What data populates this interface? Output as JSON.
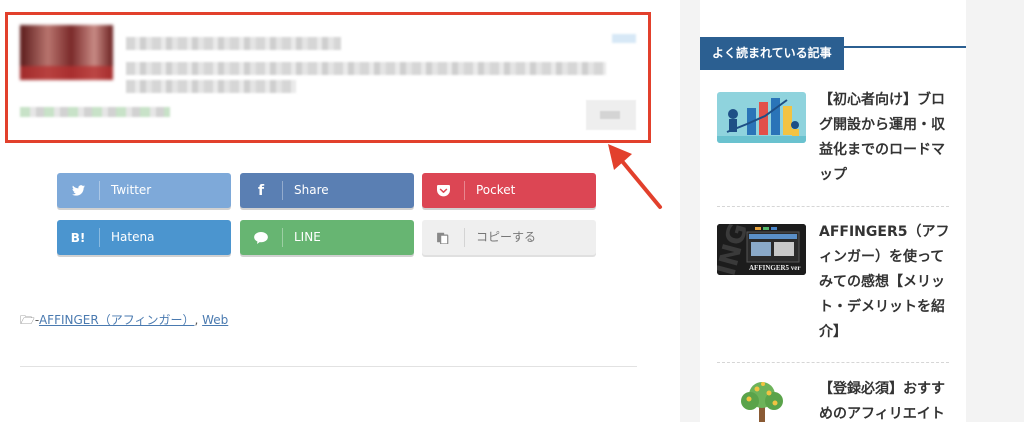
{
  "share_buttons": [
    {
      "label": "Twitter",
      "icon": "twitter-icon",
      "glyph": "🐦"
    },
    {
      "label": "Share",
      "icon": "facebook-icon",
      "glyph": "f"
    },
    {
      "label": "Pocket",
      "icon": "pocket-icon",
      "glyph": "⬡"
    },
    {
      "label": "Hatena",
      "icon": "hatena-icon",
      "glyph": "B!"
    },
    {
      "label": "LINE",
      "icon": "line-icon",
      "glyph": "💬"
    },
    {
      "label": "コピーする",
      "icon": "copy-icon",
      "glyph": "⎘"
    }
  ],
  "category": {
    "prefix": "🗁-",
    "links": [
      "AFFINGER（アフィンガー）",
      "Web"
    ],
    "separator": ", "
  },
  "sidebar": {
    "widget_title": "よく読まれている記事",
    "posts": [
      {
        "title": "【初心者向け】ブログ開設から運用・収益化までのロードマップ"
      },
      {
        "title": "AFFINGER5（アフィンガー）を使ってみての感想【メリット・デメリットを紹介】"
      },
      {
        "title": "【登録必須】おすすめのアフィリエイト"
      }
    ],
    "thumb2_text": "AFFINGER5 ver"
  },
  "colors": {
    "highlight_border": "#e2402c",
    "arrow": "#e2402c",
    "widget_accent": "#2b5f91"
  }
}
